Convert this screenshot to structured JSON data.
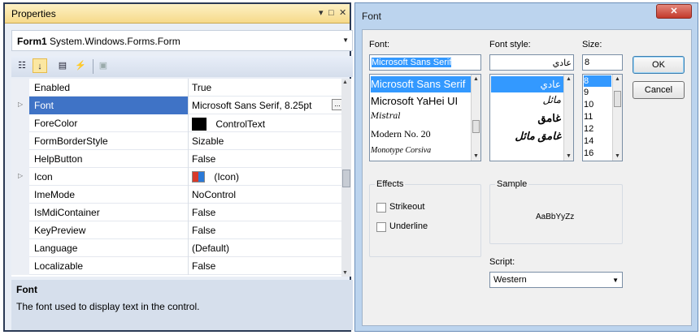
{
  "properties": {
    "title": "Properties",
    "title_controls": [
      "▾",
      "□",
      "✕"
    ],
    "object": {
      "name": "Form1",
      "type": "System.Windows.Forms.Form"
    },
    "rows": [
      {
        "name": "Enabled",
        "value": "True"
      },
      {
        "name": "Font",
        "value": "Microsoft Sans Serif, 8.25pt"
      },
      {
        "name": "ForeColor",
        "value": "ControlText"
      },
      {
        "name": "FormBorderStyle",
        "value": "Sizable"
      },
      {
        "name": "HelpButton",
        "value": "False"
      },
      {
        "name": "Icon",
        "value": "(Icon)"
      },
      {
        "name": "ImeMode",
        "value": "NoControl"
      },
      {
        "name": "IsMdiContainer",
        "value": "False"
      },
      {
        "name": "KeyPreview",
        "value": "False"
      },
      {
        "name": "Language",
        "value": "(Default)"
      },
      {
        "name": "Localizable",
        "value": "False"
      }
    ],
    "description": {
      "heading": "Font",
      "text": "The font used to display text in the control."
    }
  },
  "font_dialog": {
    "title": "Font",
    "close": "✕",
    "font_label": "Font:",
    "font_value": "Microsoft Sans Serif",
    "font_list": [
      "Microsoft Sans Serif",
      "Microsoft YaHei UI",
      "Mistral",
      "Modern No. 20",
      "Monotype Corsiva"
    ],
    "style_label": "Font style:",
    "style_value": "عادي",
    "style_list": [
      "عادي",
      "مائل",
      "غامق",
      "غامق مائل"
    ],
    "size_label": "Size:",
    "size_value": "8",
    "size_list": [
      "8",
      "9",
      "10",
      "11",
      "12",
      "14",
      "16"
    ],
    "ok": "OK",
    "cancel": "Cancel",
    "effects_label": "Effects",
    "strikeout": "Strikeout",
    "underline": "Underline",
    "sample_label": "Sample",
    "sample_text": "AaBbYyZz",
    "script_label": "Script:",
    "script_value": "Western"
  },
  "colors": {
    "selection": "#3399ff",
    "title_bar": "#f6d98a",
    "close_button": "#c33a2c"
  }
}
